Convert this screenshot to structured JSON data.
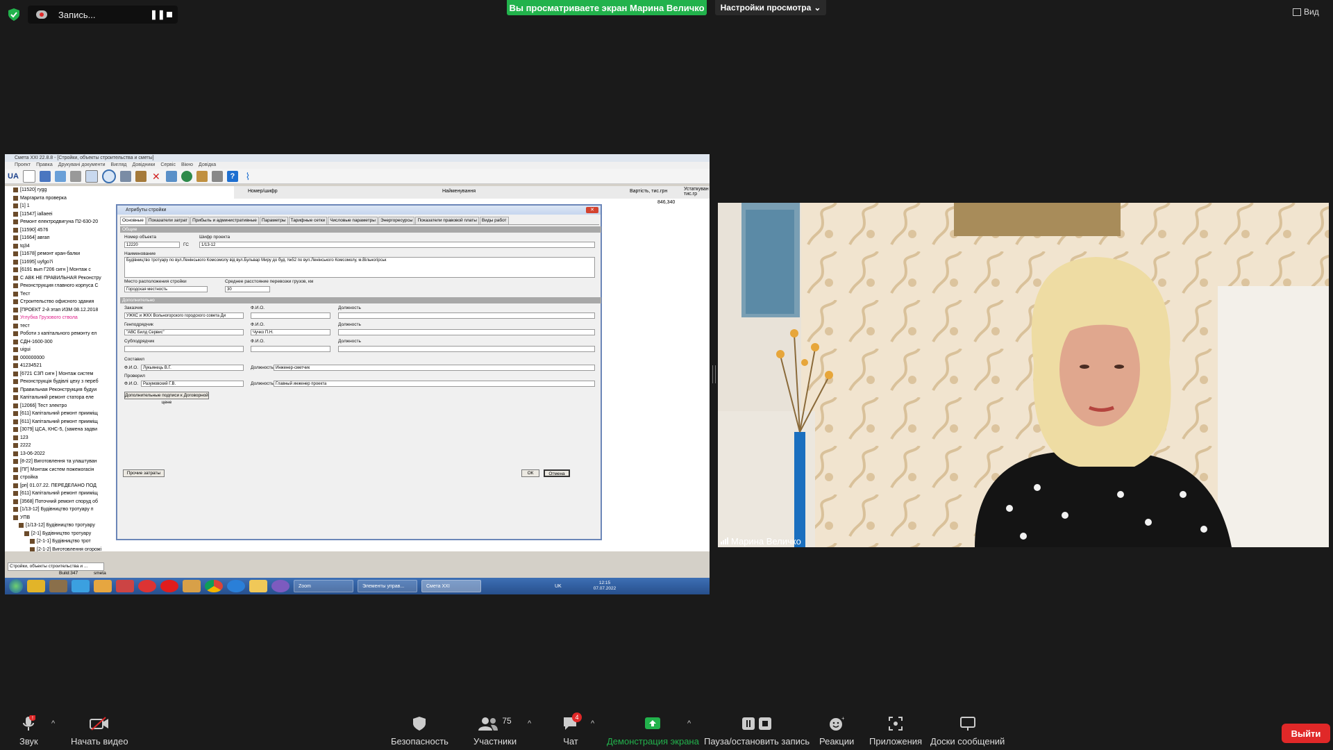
{
  "recording": {
    "label": "Запись..."
  },
  "banner": {
    "text": "Вы просматриваете экран Марина Величко",
    "view_settings": "Настройки просмотра",
    "view_button": "Вид"
  },
  "shared_app": {
    "title": "Смета XXI 22.8.8 - [Стройки, объекты строительства и сметы]",
    "menu": [
      "Проект",
      "Правка",
      "Друкувані документи",
      "Вигляд",
      "Довідники",
      "Сервіс",
      "Вікно",
      "Довідка"
    ],
    "grid_headers": [
      "Номер/шифр",
      "Найменування",
      "Вартість, тис.грн",
      "Устаткуван тис.гр"
    ],
    "grid_value": "846,340",
    "tree": [
      "[11520] rygg",
      "Маргарита проверка",
      "[1] 1",
      "[11547] iallaeei",
      "Ремонт електродвигуна П2-630-20",
      "[11590] 4576",
      "[11664] авгап",
      "tq34",
      "[11678] ремонт кран-балки",
      "[11695] uyfgo7i",
      "[6191 вып Г206 сигн ] Монтаж с",
      "С АВК НЕ ПРАВИЛЬНАЯ Реконстру",
      "Реконструкция главного корпуса С",
      "Тест",
      "Строительство офисного здания",
      "[ПРОЕКТ 2-й этап ИЗМ 08.12.2018",
      "Углубка Грузового ствола",
      "тест",
      "Роботи з капітального ремонту ел",
      "СДН-1600-300",
      "uigui",
      "000000000",
      "41234521",
      "[6721 СЗП сигн ] Монтаж систем",
      "Реконструкція будівлі цеху з переб",
      "Правильная Реконструкция будуи",
      "Капітальний ремонт статора еле",
      "[12066] Тест электро",
      "[611] Капітальний ремонт прииміщ",
      "[611] Капітальний ремонт прииміщ",
      "[3079] ЦСА, КНС-5, (замена задви",
      "123",
      "2222",
      "13-06-2022",
      "[8-22] Виготовлення та улаштуван",
      "[ПГ] Монтаж систем пожежогасін",
      "стройка",
      "[pп] 01.07.22. ПЕРЕДЕЛАНО ПОД",
      "[611] Капітальний ремонт прииміщ",
      "[3568] Поточний ремонт споруд об",
      "[1/13-12] Будівництво тротуару п",
      "УПВ",
      "[1/13-12] Будівництво тротуару",
      "[2-1] Будівництво тротуару",
      "[2-1-1] Будівництво трот",
      "[2-1-2] Виготовлення огорожі"
    ],
    "tree_highlight_index": 16,
    "status_tab": "Стройки, объекты строительства и ...",
    "status": [
      "Build:347",
      "smeta"
    ],
    "dialog": {
      "title": "Атрибуты стройки",
      "tabs": [
        "Основные",
        "Показатели затрат",
        "Прибыль и административные",
        "Параметры",
        "Тарифные сетки",
        "Числовые параметры",
        "Энергоресурсы",
        "Показатели правовой платы",
        "Виды работ"
      ],
      "section_common": "Общие",
      "object_no_label": "Номер объекта",
      "object_no": "12220",
      "gs_label": "ГС",
      "project_code_label": "Шифр проекта",
      "project_code": "1/13-12",
      "name_label": "Наименование",
      "name": "Будівництво тротуару по вул.Ленінського Комсомолу від вул.Бульвар Миру до буд. №52 по вул.Ленінського Комсомолу, м.Вільногірськ",
      "location_label": "Место расположения стройки",
      "location": "Городская местность",
      "distance_label": "Среднее расстояние перевозки грузов, км",
      "distance": "30",
      "section_extra": "Дополнительно",
      "customer_label": "Заказчик",
      "customer": "УЖКС и ЖКХ Вольногорского городского совета Ди",
      "fio_label": "Ф.И.О.",
      "position_label": "Должность",
      "contractor_label": "Генподрядчик",
      "contractor": "\"АВС Билд Сервис\"",
      "contractor_fio": "Чучко П.Н.",
      "subcontractor_label": "Субподрядчик",
      "compiled_label": "Составил",
      "compiled_fio": "Лукьянець В.Г.",
      "compiled_position": "Инженер-сметчик",
      "checked_label": "Проверил",
      "checked_fio": "Разумовский Г.В.",
      "checked_position": "Главный инженер проекта",
      "extra_signatures": "Дополнительные подписи к Договорной цене",
      "other_costs": "Прочие затраты",
      "ok": "ОК",
      "cancel": "Отмена"
    },
    "taskbar": {
      "tasks": [
        "Zoom",
        "Элементы управ...",
        "Смета XXI"
      ],
      "lang": "UK",
      "time": "12:15",
      "date": "07.07.2022"
    }
  },
  "participant": {
    "name": "Марина Величко"
  },
  "toolbar": {
    "audio": "Звук",
    "video": "Начать видео",
    "security": "Безопасность",
    "participants": "Участники",
    "participants_count": "75",
    "chat": "Чат",
    "chat_badge": "4",
    "share": "Демонстрация экрана",
    "pause": "Пауза/остановить запись",
    "reactions": "Реакции",
    "apps": "Приложения",
    "whiteboards": "Доски сообщений",
    "leave": "Выйти"
  },
  "colors": {
    "accent_green": "#22b24c",
    "leave_red": "#e02828",
    "highlight_pink": "#e0208c"
  }
}
